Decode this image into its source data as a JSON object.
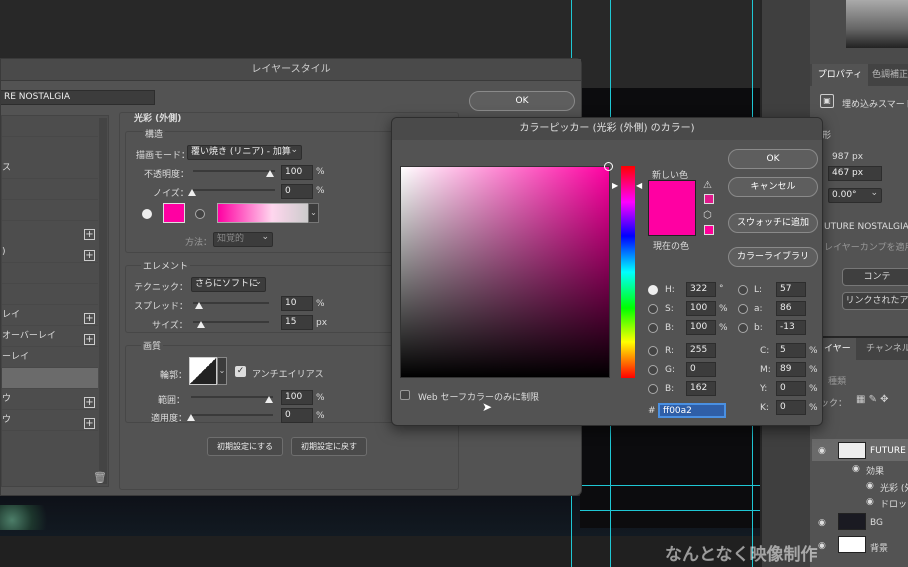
{
  "layer_style": {
    "title": "レイヤースタイル",
    "layer_name": "RE NOSTALGIA",
    "ok": "OK",
    "section_title": "光彩 (外側)",
    "structure": "構造",
    "blend_mode_label": "描画モード：",
    "blend_mode_value": "覆い焼き (リニア) - 加算",
    "opacity_label": "不透明度：",
    "opacity_value": "100",
    "noise_label": "ノイズ：",
    "noise_value": "0",
    "percent": "%",
    "method_label": "方法：",
    "method_value": "知覚的",
    "elements": "エレメント",
    "technique_label": "テクニック：",
    "technique_value": "さらにソフトに",
    "spread_label": "スプレッド：",
    "spread_value": "10",
    "size_label": "サイズ：",
    "size_value": "15",
    "px": "px",
    "quality": "画質",
    "contour_label": "輪郭：",
    "antialias_label": "アンチエイリアス",
    "range_label": "範囲：",
    "range_value": "100",
    "jitter_label": "適用度：",
    "jitter_value": "0",
    "make_default": "初期設定にする",
    "reset_default": "初期設定に戻す",
    "left_items": [
      "",
      "ス",
      "",
      "",
      ")",
      "",
      "",
      "レイ",
      "オーバーレイ",
      "ーレイ",
      "",
      "ウ",
      "ウ"
    ],
    "glow_color": "#ff00a2"
  },
  "color_picker": {
    "title": "カラーピッカー (光彩 (外側) のカラー)",
    "ok": "OK",
    "cancel": "キャンセル",
    "add_swatch": "スウォッチに追加",
    "color_library": "カラーライブラリ",
    "new_label": "新しい色",
    "current_label": "現在の色",
    "web_only": "Web セーフカラーのみに制限",
    "h_label": "H:",
    "h_value": "322",
    "h_unit": "°",
    "s_label": "S:",
    "s_value": "100",
    "s_unit": "%",
    "b_label": "B:",
    "b_value": "100",
    "b_unit": "%",
    "r_label": "R:",
    "r_value": "255",
    "g_label": "G:",
    "g_value": "0",
    "bl_label": "B:",
    "bl_value": "162",
    "l_label": "L:",
    "l_value": "57",
    "a_label": "a:",
    "a_value": "86",
    "lb_label": "b:",
    "lb_value": "-13",
    "c_label": "C:",
    "c_value": "5",
    "m_label": "M:",
    "m_value": "89",
    "y_label": "Y:",
    "y_value": "0",
    "k_label": "K:",
    "k_value": "0",
    "pct": "%",
    "hash": "#",
    "hex_value": "ff00a2",
    "new_color": "#ff00a2",
    "current_color": "#ff00a2"
  },
  "right_panel": {
    "tab_properties": "プロパティ",
    "tab_adjust": "色調補正",
    "smart_object": "埋め込みスマート",
    "shape_label": "形",
    "w_value": "987 px",
    "h_value": "467 px",
    "angle_value": "0.00°",
    "filename": "UTURE NOSTALGIA.",
    "layer_comp": "レイヤーカンプを適用",
    "content_btn": "コンテ",
    "linked_btn": "リンクされたア",
    "tab_layers": "イヤー",
    "tab_channels": "チャンネル",
    "kind": "種類",
    "lock": "ック：",
    "layers": [
      {
        "name": "FUTURE",
        "indent": 0
      },
      {
        "name": "効果",
        "indent": 1
      },
      {
        "name": "光彩 (外",
        "indent": 2
      },
      {
        "name": "ドロップ",
        "indent": 2
      },
      {
        "name": "BG",
        "indent": 0
      },
      {
        "name": "背景",
        "indent": 0
      }
    ]
  },
  "watermark": "なんとなく映像制作"
}
